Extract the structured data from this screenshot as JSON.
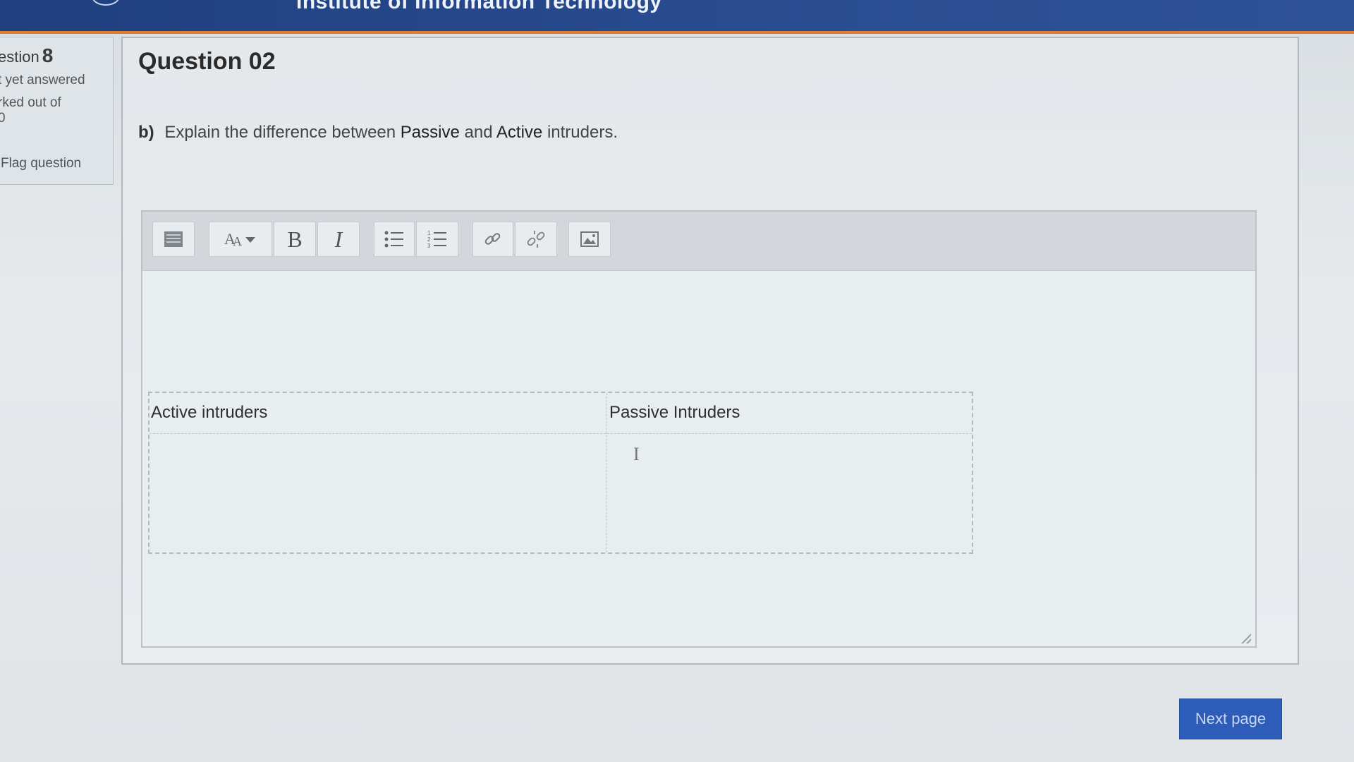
{
  "header": {
    "title": "Institute of Information Technology"
  },
  "info": {
    "question_label": "estion",
    "question_number": "8",
    "status": "t yet answered",
    "marked_line1": "rked out of",
    "marked_line2": "0",
    "flag_label": "Flag question"
  },
  "question": {
    "title": "Question 02",
    "part_label": "b)",
    "text_before": "Explain the difference between",
    "term_passive": "Passive",
    "text_and": "and",
    "term_active": "Active",
    "text_after": "intruders."
  },
  "toolbar": {
    "icons": [
      "toolbar-toggle-icon",
      "paragraph-styles-icon",
      "bold-icon",
      "italic-icon",
      "unordered-list-icon",
      "ordered-list-icon",
      "link-icon",
      "unlink-icon",
      "image-icon"
    ],
    "bold_label": "B",
    "italic_label": "I"
  },
  "answer_table": {
    "headers": [
      "Active intruders",
      "Passive Intruders"
    ]
  },
  "buttons": {
    "next": "Next page"
  }
}
